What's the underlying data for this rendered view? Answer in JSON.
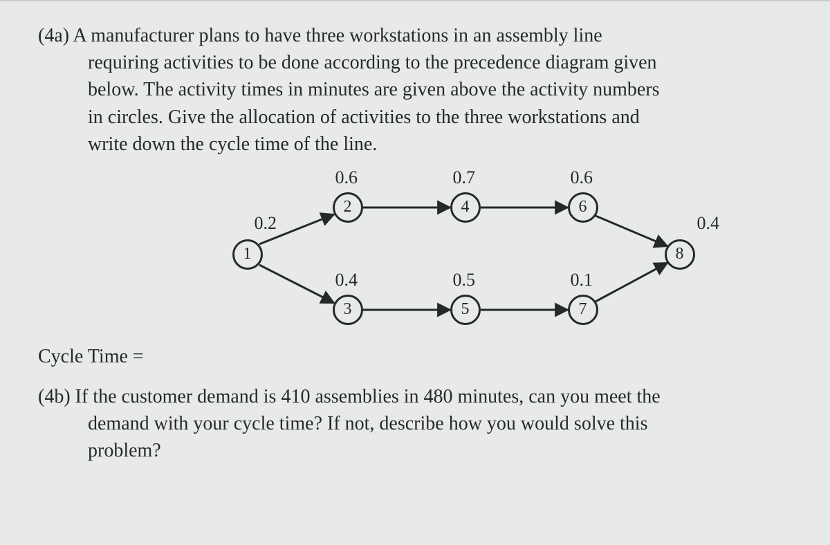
{
  "q4a": {
    "num": "(4a)",
    "line1": "A manufacturer plans to have three workstations in an assembly line",
    "line2": "requiring activities to be done according to the precedence diagram given",
    "line3": "below.  The activity times in minutes are given above the activity numbers",
    "line4": "in circles.  Give the allocation of activities to the three workstations and",
    "line5": "write down the cycle time of the line."
  },
  "diagram": {
    "nodes": {
      "n1": "1",
      "n2": "2",
      "n3": "3",
      "n4": "4",
      "n5": "5",
      "n6": "6",
      "n7": "7",
      "n8": "8"
    },
    "times": {
      "t1": "0.2",
      "t2": "0.6",
      "t3": "0.4",
      "t4": "0.7",
      "t5": "0.5",
      "t6": "0.6",
      "t7": "0.1",
      "t8": "0.4"
    }
  },
  "cycle": "Cycle Time =",
  "q4b": {
    "num": "(4b)",
    "line1": "If the customer demand is 410 assemblies in 480 minutes, can you meet the",
    "line2": "demand with your cycle time?  If not, describe how you would solve this",
    "line3": "problem?"
  }
}
